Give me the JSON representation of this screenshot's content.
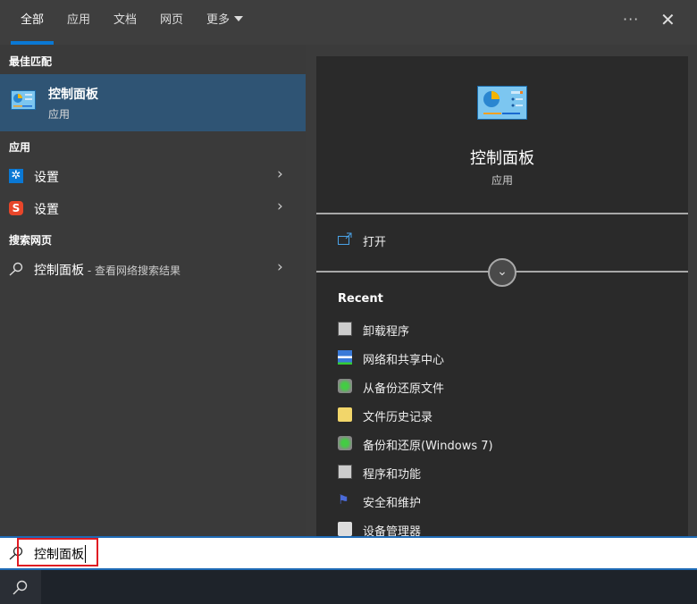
{
  "tabs": [
    {
      "label": "全部"
    },
    {
      "label": "应用"
    },
    {
      "label": "文档"
    },
    {
      "label": "网页"
    },
    {
      "label": "更多"
    }
  ],
  "more_label": "···",
  "close_label": "✕",
  "left": {
    "best_match_heading": "最佳匹配",
    "best_match": {
      "title": "控制面板",
      "subtitle": "应用"
    },
    "apps_heading": "应用",
    "apps": [
      {
        "label": "设置"
      },
      {
        "label": "设置"
      }
    ],
    "web_heading": "搜索网页",
    "web": {
      "label": "控制面板",
      "suffix": " - 查看网络搜索结果"
    }
  },
  "right": {
    "title": "控制面板",
    "subtitle": "应用",
    "open_label": "打开",
    "recent_heading": "Recent",
    "recent": [
      {
        "label": "卸载程序"
      },
      {
        "label": "网络和共享中心"
      },
      {
        "label": "从备份还原文件"
      },
      {
        "label": "文件历史记录"
      },
      {
        "label": "备份和还原(Windows 7)"
      },
      {
        "label": "程序和功能"
      },
      {
        "label": "安全和维护"
      },
      {
        "label": "设备管理器"
      }
    ]
  },
  "search": {
    "value": "控制面板"
  },
  "colors": {
    "accent": "#0a78d4",
    "selected": "#2f5474",
    "highlight_box": "#e01a22"
  }
}
